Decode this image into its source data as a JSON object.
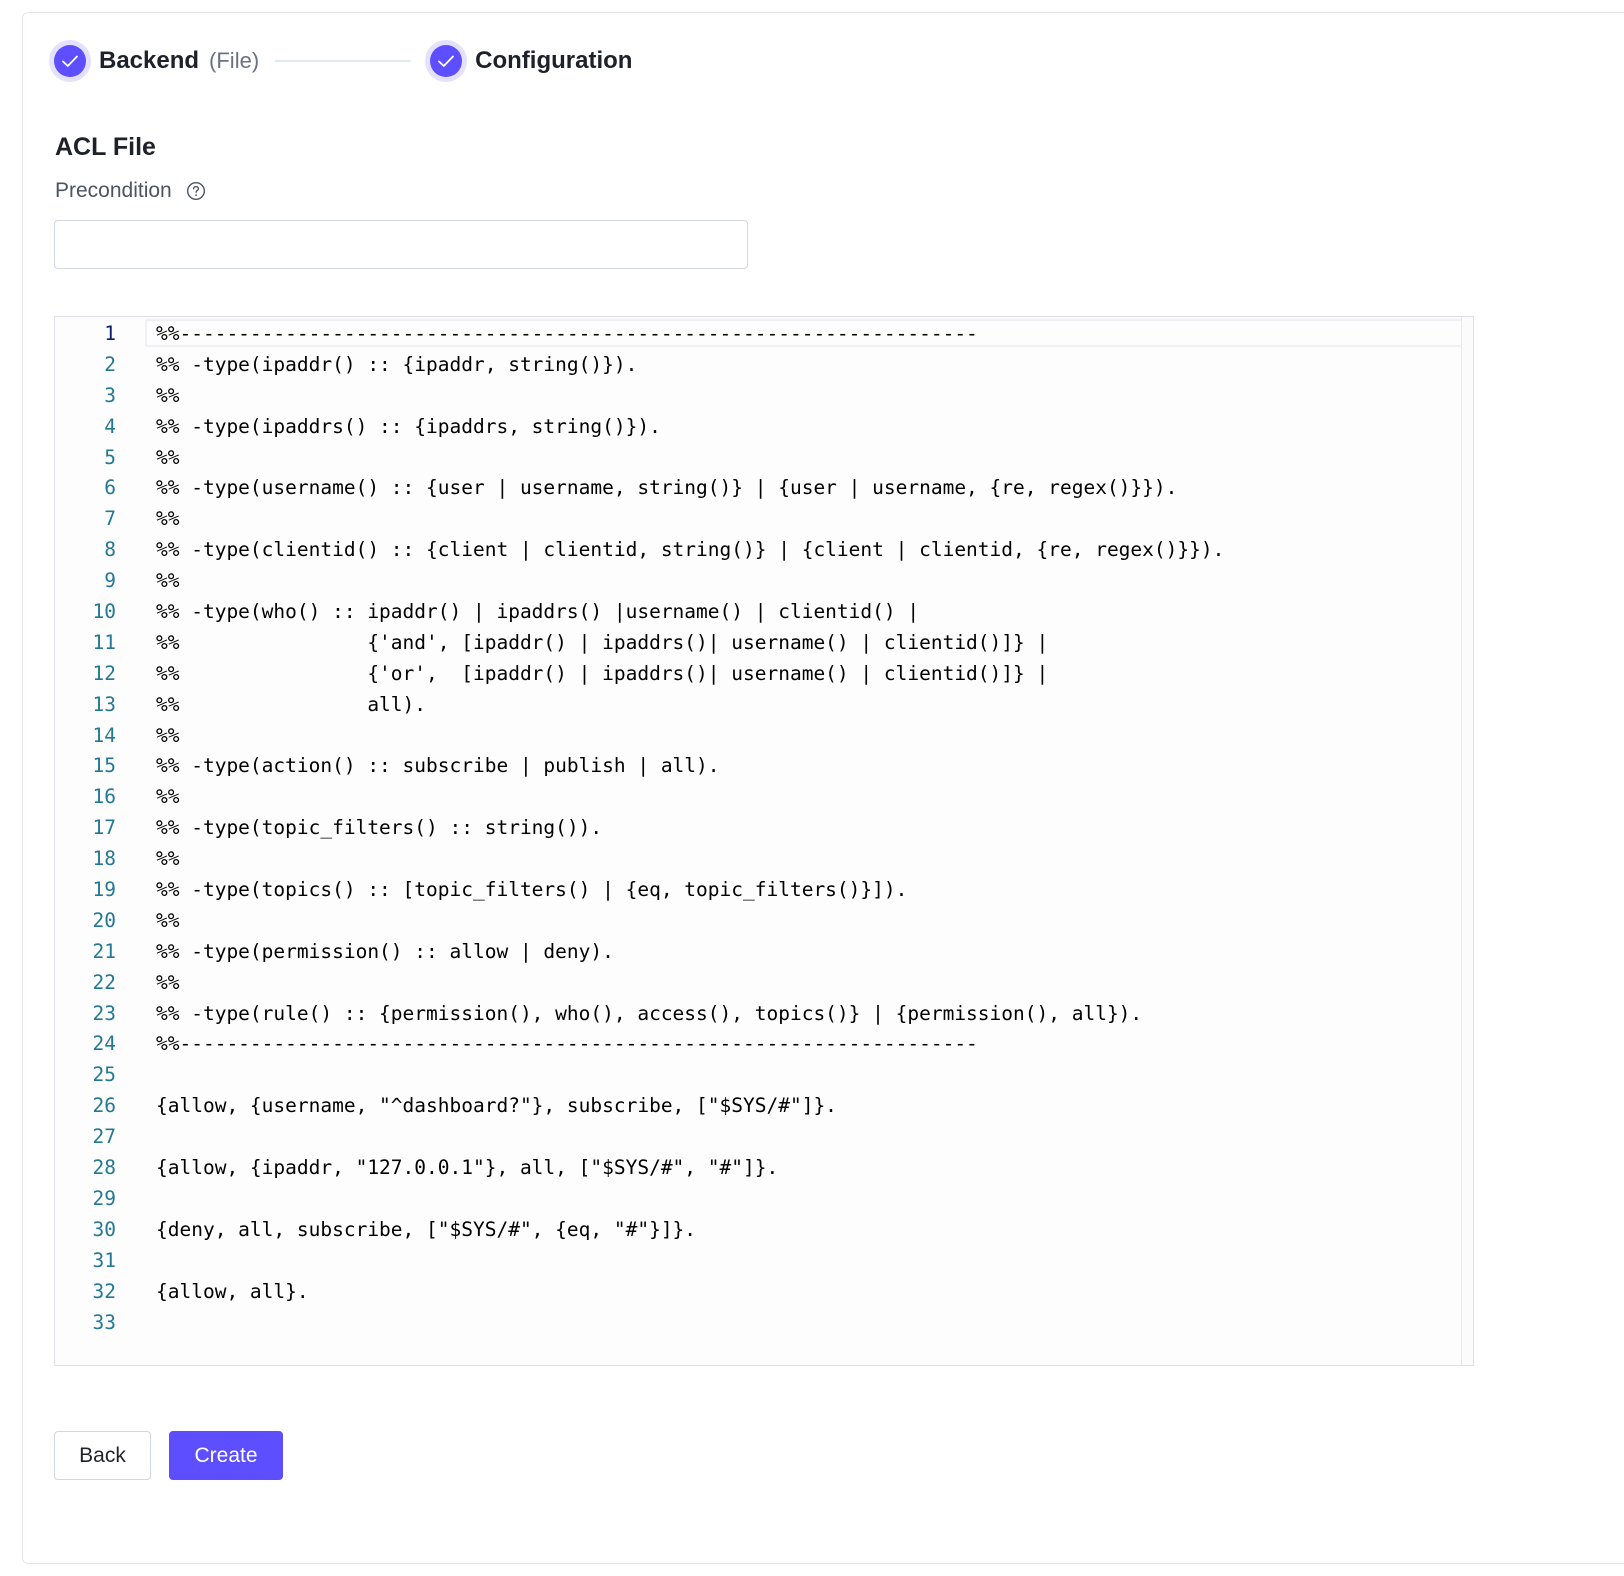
{
  "steps": [
    {
      "title": "Backend",
      "subtitle": "(File)",
      "status": "complete"
    },
    {
      "title": "Configuration",
      "subtitle": "",
      "status": "complete"
    }
  ],
  "section_title": "ACL File",
  "precondition": {
    "label": "Precondition",
    "value": "",
    "placeholder": ""
  },
  "editor": {
    "active_line": 1,
    "lines": [
      "%%--------------------------------------------------------------------",
      "%% -type(ipaddr() :: {ipaddr, string()}).",
      "%%",
      "%% -type(ipaddrs() :: {ipaddrs, string()}).",
      "%%",
      "%% -type(username() :: {user | username, string()} | {user | username, {re, regex()}}).",
      "%%",
      "%% -type(clientid() :: {client | clientid, string()} | {client | clientid, {re, regex()}}).",
      "%%",
      "%% -type(who() :: ipaddr() | ipaddrs() |username() | clientid() |",
      "%%                {'and', [ipaddr() | ipaddrs()| username() | clientid()]} |",
      "%%                {'or',  [ipaddr() | ipaddrs()| username() | clientid()]} |",
      "%%                all).",
      "%%",
      "%% -type(action() :: subscribe | publish | all).",
      "%%",
      "%% -type(topic_filters() :: string()).",
      "%%",
      "%% -type(topics() :: [topic_filters() | {eq, topic_filters()}]).",
      "%%",
      "%% -type(permission() :: allow | deny).",
      "%%",
      "%% -type(rule() :: {permission(), who(), access(), topics()} | {permission(), all}).",
      "%%--------------------------------------------------------------------",
      "",
      "{allow, {username, \"^dashboard?\"}, subscribe, [\"$SYS/#\"]}.",
      "",
      "{allow, {ipaddr, \"127.0.0.1\"}, all, [\"$SYS/#\", \"#\"]}.",
      "",
      "{deny, all, subscribe, [\"$SYS/#\", {eq, \"#\"}]}.",
      "",
      "{allow, all}.",
      ""
    ]
  },
  "buttons": {
    "back_label": "Back",
    "create_label": "Create"
  },
  "colors": {
    "accent": "#5d4eff",
    "accent_light": "#e4e1ff",
    "line_number": "#237893",
    "line_number_active": "#0b216f"
  },
  "icons": {
    "step_complete": "check-icon",
    "help": "question-circle-icon"
  }
}
